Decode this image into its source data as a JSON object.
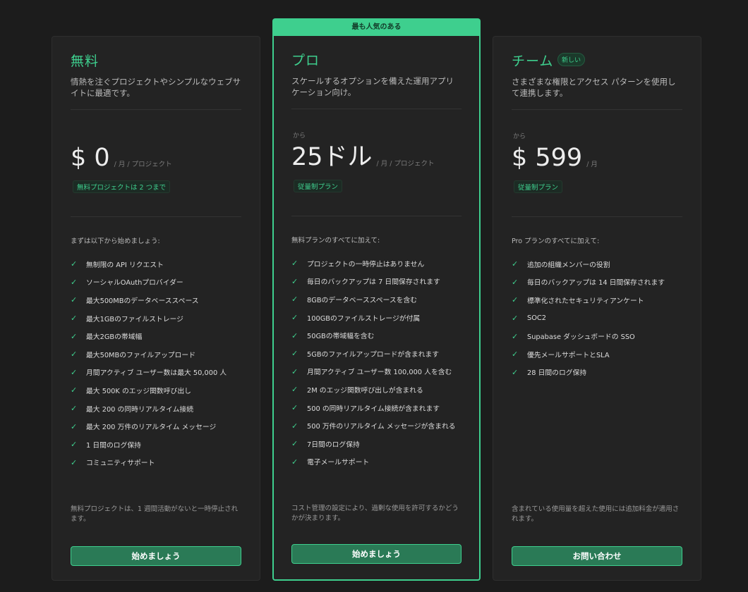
{
  "colors": {
    "accent": "#3ecf8e",
    "background": "#1c1c1c",
    "card": "#232323",
    "button": "#2a7a56"
  },
  "popular_label": "最も人気のある",
  "plans": [
    {
      "name": "無料",
      "description": "情熱を注ぐプロジェクトやシンプルなウェブサイトに最適です。",
      "from_label": "",
      "price": "$ 0",
      "period": "/ 月 / プロジェクト",
      "pill": "無料プロジェクトは 2 つまで",
      "intro": "まずは以下から始めましょう:",
      "features": [
        "無制限の API リクエスト",
        "ソーシャルOAuthプロバイダー",
        "最大500MBのデータベーススペース",
        "最大1GBのファイルストレージ",
        "最大2GBの帯域幅",
        "最大50MBのファイルアップロード",
        "月間アクティブ ユーザー数は最大 50,000 人",
        "最大 500K のエッジ関数呼び出し",
        "最大 200 の同時リアルタイム接続",
        "最大 200 万件のリアルタイム メッセージ",
        "1 日間のログ保持",
        "コミュニティサポート"
      ],
      "footnote": "無料プロジェクトは、1 週間活動がないと一時停止されます。",
      "cta": "始めましょう"
    },
    {
      "name": "プロ",
      "description": "スケールするオプションを備えた運用アプリケーション向け。",
      "from_label": "から",
      "price": "25ドル",
      "period": "/ 月 / プロジェクト",
      "pill": "従量制プラン",
      "intro": "無料プランのすべてに加えて:",
      "features": [
        "プロジェクトの一時停止はありません",
        "毎日のバックアップは 7 日間保存されます",
        "8GBのデータベーススペースを含む",
        "100GBのファイルストレージが付属",
        "50GBの帯域幅を含む",
        "5GBのファイルアップロードが含まれます",
        "月間アクティブ ユーザー数 100,000 人を含む",
        "2M のエッジ関数呼び出しが含まれる",
        "500 の同時リアルタイム接続が含まれます",
        "500 万件のリアルタイム メッセージが含まれる",
        "7日間のログ保持",
        "電子メールサポート"
      ],
      "footnote": "コスト管理の設定により、過剰な使用を許可するかどうかが決まります。",
      "cta": "始めましょう"
    },
    {
      "name": "チーム",
      "badge": "新しい",
      "description": "さまざまな権限とアクセス パターンを使用して連携します。",
      "from_label": "から",
      "price": "$ 599",
      "period": "/ 月",
      "pill": "従量制プラン",
      "intro": "Pro プランのすべてに加えて:",
      "features": [
        "追加の組織メンバーの役割",
        "毎日のバックアップは 14 日間保存されます",
        "標準化されたセキュリティアンケート",
        "SOC2",
        "Supabase ダッシュボードの SSO",
        "優先メールサポートとSLA",
        "28 日間のログ保持"
      ],
      "footnote": "含まれている使用量を超えた使用には追加料金が適用されます。",
      "cta": "お問い合わせ"
    }
  ]
}
